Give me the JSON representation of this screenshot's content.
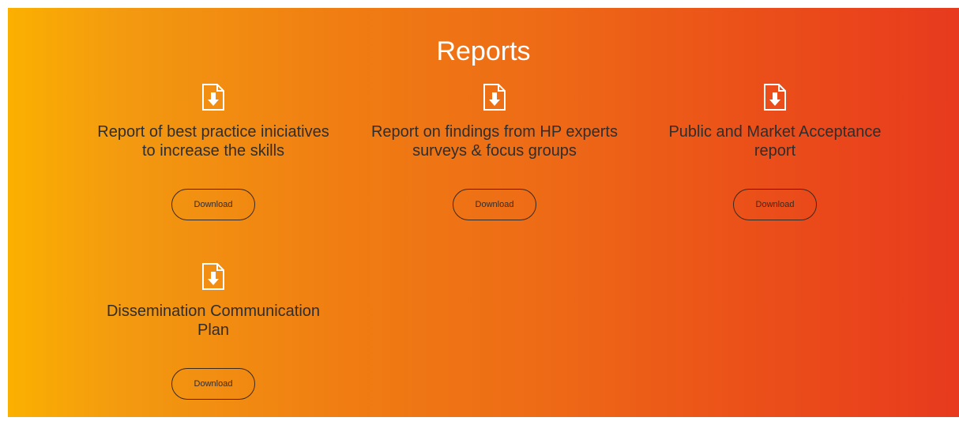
{
  "section": {
    "title": "Reports"
  },
  "reports": [
    {
      "title_line1": "Report of best practice iniciatives",
      "title_line2": "to increase the skills",
      "button_label": "Download",
      "icon": "file-download-icon"
    },
    {
      "title_line1": "Report on findings from HP experts",
      "title_line2": "surveys & focus groups",
      "button_label": "Download",
      "icon": "file-download-icon"
    },
    {
      "title_line1": "Public and Market Acceptance",
      "title_line2": "report",
      "button_label": "Download",
      "icon": "file-download-icon"
    },
    {
      "title_line1": "Dissemination Communication",
      "title_line2": "Plan",
      "button_label": "Download",
      "icon": "file-download-icon"
    }
  ],
  "colors": {
    "gradient_start": "#fbb000",
    "gradient_end": "#e83a1e",
    "heading": "#ffffff",
    "text": "#2e2e2e"
  }
}
